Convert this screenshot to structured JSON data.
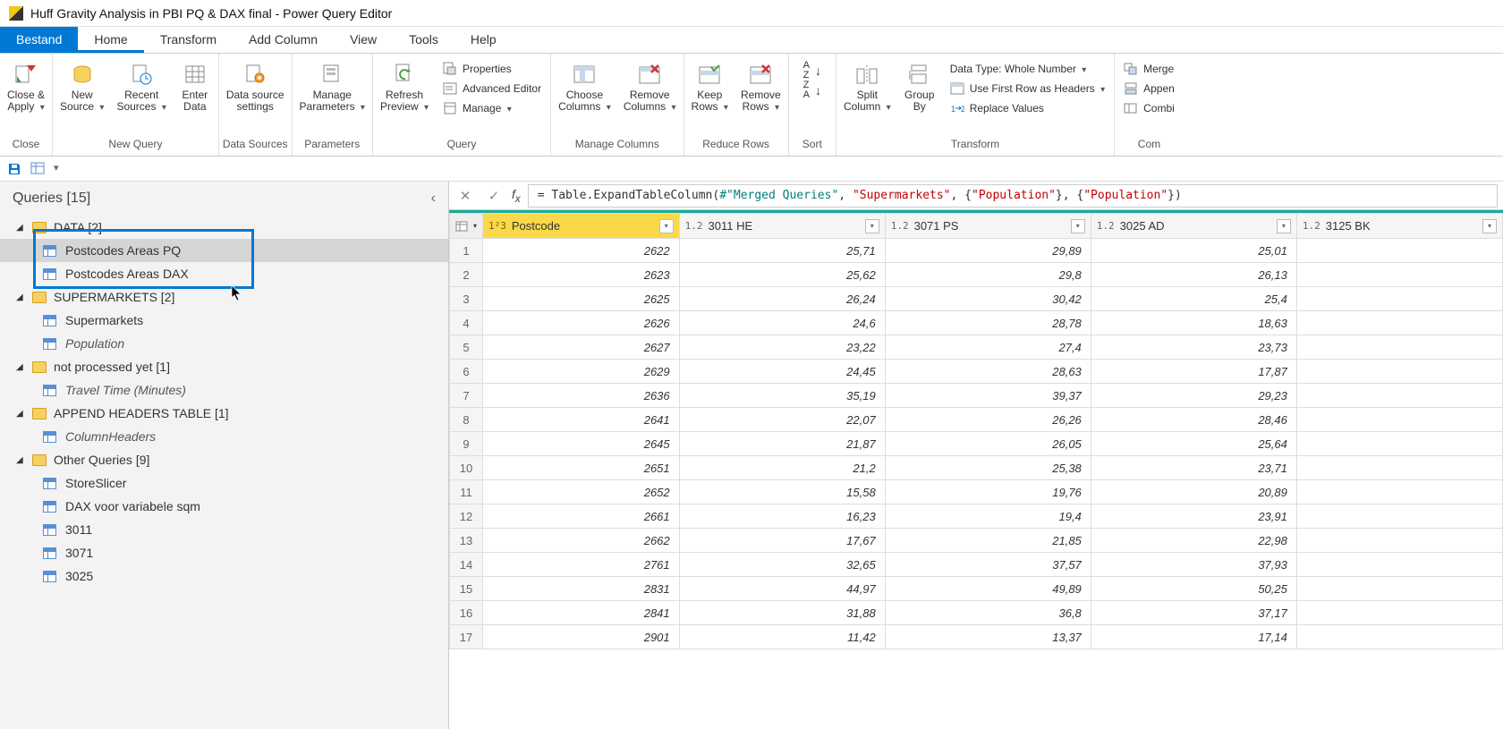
{
  "window": {
    "title": "Huff Gravity Analysis in PBI PQ & DAX final - Power Query Editor"
  },
  "tabs": {
    "file": "Bestand",
    "items": [
      "Home",
      "Transform",
      "Add Column",
      "View",
      "Tools",
      "Help"
    ],
    "active": 0
  },
  "ribbon": {
    "close": {
      "label": "Close",
      "buttons": [
        {
          "label": "Close &\nApply",
          "dd": true
        }
      ]
    },
    "newquery": {
      "label": "New Query",
      "buttons": [
        {
          "label": "New\nSource",
          "dd": true
        },
        {
          "label": "Recent\nSources",
          "dd": true
        },
        {
          "label": "Enter\nData"
        }
      ]
    },
    "datasources": {
      "label": "Data Sources",
      "buttons": [
        {
          "label": "Data source\nsettings"
        }
      ]
    },
    "parameters": {
      "label": "Parameters",
      "buttons": [
        {
          "label": "Manage\nParameters",
          "dd": true
        }
      ]
    },
    "query": {
      "label": "Query",
      "buttons": [
        {
          "label": "Refresh\nPreview",
          "dd": true
        }
      ],
      "small": [
        {
          "label": "Properties"
        },
        {
          "label": "Advanced Editor"
        },
        {
          "label": "Manage",
          "dd": true
        }
      ]
    },
    "managecols": {
      "label": "Manage Columns",
      "buttons": [
        {
          "label": "Choose\nColumns",
          "dd": true
        },
        {
          "label": "Remove\nColumns",
          "dd": true
        }
      ]
    },
    "reducerows": {
      "label": "Reduce Rows",
      "buttons": [
        {
          "label": "Keep\nRows",
          "dd": true
        },
        {
          "label": "Remove\nRows",
          "dd": true
        }
      ]
    },
    "sort": {
      "label": "Sort"
    },
    "transform": {
      "label": "Transform",
      "buttons": [
        {
          "label": "Split\nColumn",
          "dd": true
        },
        {
          "label": "Group\nBy"
        }
      ],
      "small": [
        {
          "label": "Data Type: Whole Number",
          "dd": true
        },
        {
          "label": "Use First Row as Headers",
          "dd": true
        },
        {
          "label": "Replace Values"
        }
      ]
    },
    "combine": {
      "label": "Com",
      "small": [
        {
          "label": "Merge"
        },
        {
          "label": "Appen"
        },
        {
          "label": "Combi"
        }
      ]
    }
  },
  "sidebar": {
    "title": "Queries [15]",
    "groups": [
      {
        "name": "DATA [2]",
        "items": [
          {
            "label": "Postcodes Areas PQ",
            "selected": true
          },
          {
            "label": "Postcodes Areas DAX"
          }
        ]
      },
      {
        "name": "SUPERMARKETS [2]",
        "items": [
          {
            "label": "Supermarkets"
          },
          {
            "label": "Population",
            "italic": true
          }
        ]
      },
      {
        "name": "not processed yet [1]",
        "items": [
          {
            "label": "Travel Time (Minutes)",
            "italic": true
          }
        ]
      },
      {
        "name": "APPEND HEADERS TABLE [1]",
        "items": [
          {
            "label": "ColumnHeaders",
            "italic": true
          }
        ]
      },
      {
        "name": "Other Queries [9]",
        "items": [
          {
            "label": "StoreSlicer"
          },
          {
            "label": "DAX voor variabele sqm"
          },
          {
            "label": "3011"
          },
          {
            "label": "3071"
          },
          {
            "label": "3025"
          }
        ]
      }
    ]
  },
  "formula": {
    "prefix": "= Table.ExpandTableColumn(",
    "arg1": "#\"Merged Queries\"",
    "sep": ", ",
    "arg2": "\"Supermarkets\"",
    "arg3": "{\"Population\"}",
    "arg4": "{\"Population\"}",
    "suffix": ")"
  },
  "columns": [
    {
      "type": "1²3",
      "name": "Postcode",
      "active": true
    },
    {
      "type": "1.2",
      "name": "3011 HE"
    },
    {
      "type": "1.2",
      "name": "3071 PS"
    },
    {
      "type": "1.2",
      "name": "3025 AD"
    },
    {
      "type": "1.2",
      "name": "3125 BK"
    }
  ],
  "rows": [
    [
      "2622",
      "25,71",
      "29,89",
      "25,01",
      ""
    ],
    [
      "2623",
      "25,62",
      "29,8",
      "26,13",
      ""
    ],
    [
      "2625",
      "26,24",
      "30,42",
      "25,4",
      ""
    ],
    [
      "2626",
      "24,6",
      "28,78",
      "18,63",
      ""
    ],
    [
      "2627",
      "23,22",
      "27,4",
      "23,73",
      ""
    ],
    [
      "2629",
      "24,45",
      "28,63",
      "17,87",
      ""
    ],
    [
      "2636",
      "35,19",
      "39,37",
      "29,23",
      ""
    ],
    [
      "2641",
      "22,07",
      "26,26",
      "28,46",
      ""
    ],
    [
      "2645",
      "21,87",
      "26,05",
      "25,64",
      ""
    ],
    [
      "2651",
      "21,2",
      "25,38",
      "23,71",
      ""
    ],
    [
      "2652",
      "15,58",
      "19,76",
      "20,89",
      ""
    ],
    [
      "2661",
      "16,23",
      "19,4",
      "23,91",
      ""
    ],
    [
      "2662",
      "17,67",
      "21,85",
      "22,98",
      ""
    ],
    [
      "2761",
      "32,65",
      "37,57",
      "37,93",
      ""
    ],
    [
      "2831",
      "44,97",
      "49,89",
      "50,25",
      ""
    ],
    [
      "2841",
      "31,88",
      "36,8",
      "37,17",
      ""
    ],
    [
      "2901",
      "11,42",
      "13,37",
      "17,14",
      ""
    ]
  ],
  "icons": {
    "sortAsc": "A↓Z",
    "sortDesc": "Z↓A"
  }
}
